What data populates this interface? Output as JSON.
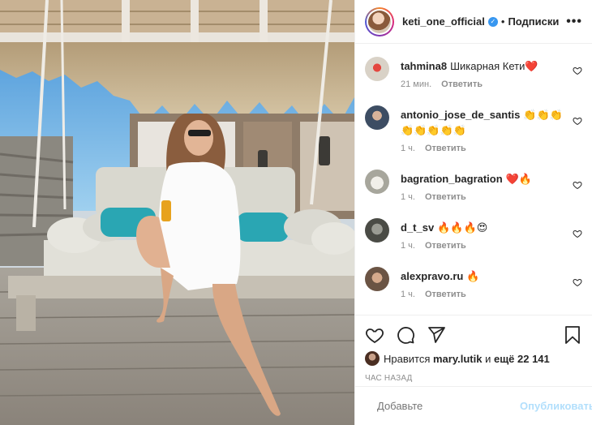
{
  "header": {
    "username": "keti_one_official",
    "separator": "•",
    "follow_label": "Подписки",
    "more_label": "•••"
  },
  "comments": [
    {
      "user": "tahmina8",
      "text": "Шикарная Кети❤️",
      "time": "21 мин.",
      "reply": "Ответить",
      "avatar_color": "#c9c0b6"
    },
    {
      "user": "antonio_jose_de_santis",
      "text": "👏👏👏👏👏👏👏👏",
      "time": "1 ч.",
      "reply": "Ответить",
      "avatar_color": "#7f8fa0"
    },
    {
      "user": "bagration_bagration",
      "text": "❤️🔥",
      "time": "1 ч.",
      "reply": "Ответить",
      "avatar_color": "#c9c6bd"
    },
    {
      "user": "d_t_sv",
      "text": "🔥🔥🔥😍",
      "time": "1 ч.",
      "reply": "Ответить",
      "avatar_color": "#6d6e66"
    },
    {
      "user": "alexpravo.ru",
      "text": "🔥",
      "time": "1 ч.",
      "reply": "Ответить",
      "avatar_color": "#a0836e"
    }
  ],
  "likes": {
    "prefix": "Нравится",
    "user": "mary.lutik",
    "middle": "и",
    "count": "ещё 22 141"
  },
  "post_time": "ЧАС НАЗАД",
  "add_comment": {
    "placeholder": "Добавьте",
    "post_label": "Опубликовать"
  },
  "colors": {
    "accent_blue": "#3897f0",
    "post_disabled": "#b2dffc",
    "meta_gray": "#8e8e8e"
  }
}
